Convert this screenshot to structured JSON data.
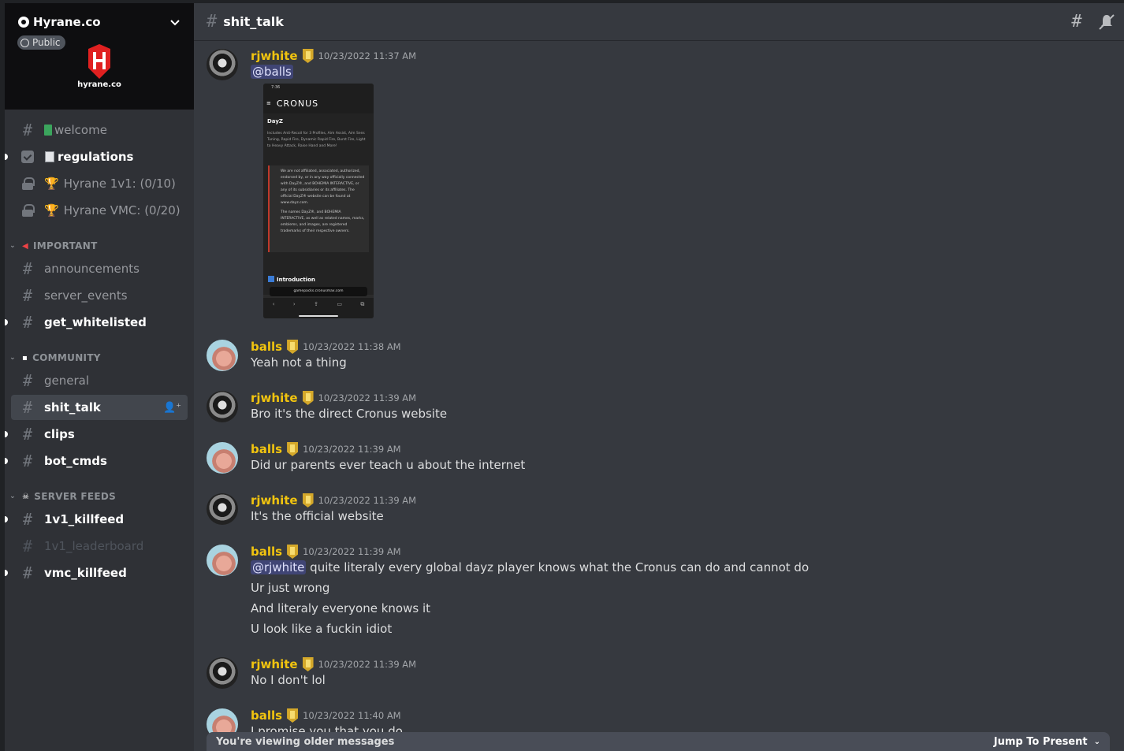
{
  "server": {
    "name": "Hyrane.co",
    "visibility": "Public",
    "logo_text": "hyrane.co"
  },
  "channels": {
    "welcome": "welcome",
    "regulations": "regulations",
    "hyrane_1v1": "Hyrane 1v1: (0/10)",
    "hyrane_vmc": "Hyrane VMC: (0/20)",
    "cat_important": "IMPORTANT",
    "announcements": "announcements",
    "server_events": "server_events",
    "get_whitelisted": "get_whitelisted",
    "cat_community": "COMMUNITY",
    "general": "general",
    "shit_talk": "shit_talk",
    "clips": "clips",
    "bot_cmds": "bot_cmds",
    "cat_server_feeds": "SERVER FEEDS",
    "killfeed_1v1": "1v1_killfeed",
    "leaderboard_1v1": "1v1_leaderboard",
    "vmc_killfeed": "vmc_killfeed"
  },
  "header": {
    "channel_title": "shit_talk"
  },
  "attachment": {
    "time": "7:36",
    "brand": "CRONUS",
    "title": "DayZ",
    "desc": "Includes Anti-Recoil for 3 Profiles, Aim Assist, Aim Sens Tuning, Rapid Fire, Dynamic Rapid Fire, Burst Fire, Light to Heavy Attack, Raise Hand and More!",
    "warning1": "We are not affiliated, associated, authorized, endorsed by, or in any way officially connected with DayZ®, and BOHEMIA INTERACTIVE, or any of its subsidiaries or its affiliates. The official DayZ® website can be found at www.dayz.com.",
    "warning2": "The names DayZ®, and BOHEMIA INTERACTIVE, as well as related names, marks, emblems, and images, are registered trademarks of their respective owners.",
    "intro": "Introduction",
    "url": "gamepacks.cronusmax.com"
  },
  "messages": [
    {
      "user": "rjwhite",
      "time": "10/23/2022 11:37 AM",
      "lines": [
        "@balls"
      ]
    },
    {
      "user": "balls",
      "time": "10/23/2022 11:38 AM",
      "lines": [
        "Yeah not a thing"
      ]
    },
    {
      "user": "rjwhite",
      "time": "10/23/2022 11:39 AM",
      "lines": [
        "Bro it's the direct Cronus website"
      ]
    },
    {
      "user": "balls",
      "time": "10/23/2022 11:39 AM",
      "lines": [
        "Did ur parents ever teach u about the internet"
      ]
    },
    {
      "user": "rjwhite",
      "time": "10/23/2022 11:39 AM",
      "lines": [
        "It's the official website"
      ]
    },
    {
      "user": "balls",
      "time": "10/23/2022 11:39 AM",
      "mention": "@rjwhite",
      "lines": [
        "quite literaly every global dayz player knows what the Cronus can do and cannot do",
        "Ur just wrong",
        "And literaly everyone knows it",
        "U look like a fuckin idiot"
      ]
    },
    {
      "user": "rjwhite",
      "time": "10/23/2022 11:39 AM",
      "lines": [
        "No I don't lol"
      ]
    },
    {
      "user": "balls",
      "time": "10/23/2022 11:40 AM",
      "lines": [
        "I promise you that you do"
      ]
    }
  ],
  "older_bar": {
    "text": "You're viewing older messages",
    "jump": "Jump To Present"
  },
  "colors": {
    "username": "#f1c40f",
    "sidebar_bg": "#2f3136",
    "chat_bg": "#36393f",
    "mention_bg": "#414675"
  },
  "icons": [
    "hashtag-icon",
    "threads-icon",
    "mute-icon",
    "lock-icon",
    "trophy-icon",
    "chevron-down-icon",
    "add-member-icon",
    "globe-icon"
  ]
}
